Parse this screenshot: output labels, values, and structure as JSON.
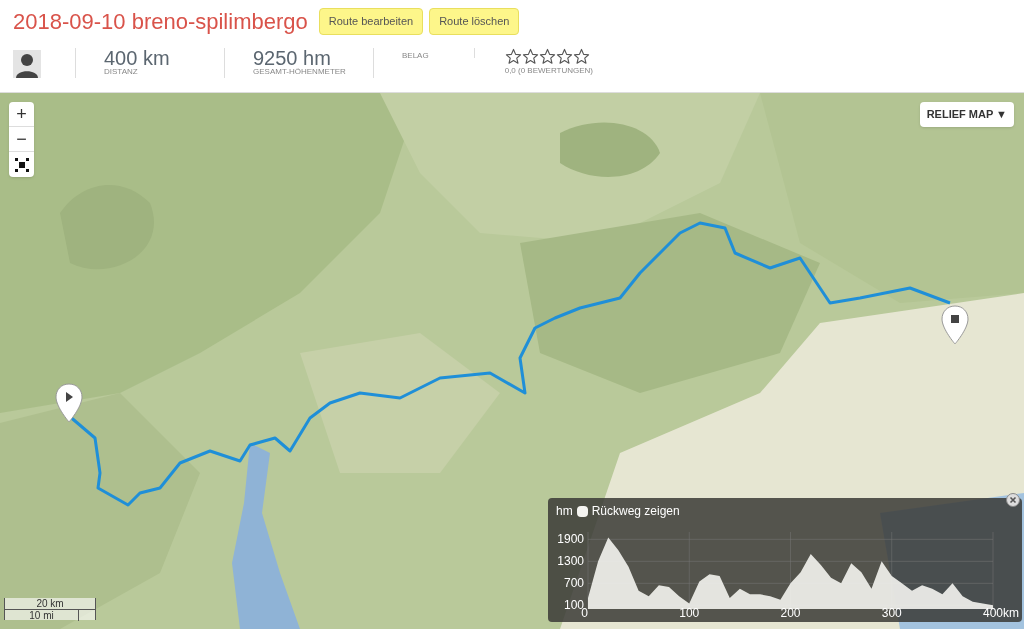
{
  "title": "2018-09-10 breno-spilimbergo",
  "actions": [
    "Route bearbeiten",
    "Route löschen"
  ],
  "stats": [
    {
      "value": "400 km",
      "label": "DISTANZ"
    },
    {
      "value": "9250 hm",
      "label": "GESAMT-HÖHENMETER"
    }
  ],
  "surface_label": "BELAG",
  "rating": {
    "stars": 0,
    "text": "0,0 (0 BEWERTUNGEN)"
  },
  "map": {
    "kind": "picture",
    "zoom_controls": [
      "+",
      "−"
    ],
    "layer_button": "RELIEF MAP ▼",
    "scale": [
      "20 km",
      "10 mi"
    ],
    "elevation": {
      "unit": "hm",
      "toggle_label": "Rückweg zeigen",
      "checked": false,
      "chart_data": {
        "type": "area",
        "xlabel": "km",
        "x": [
          0,
          10,
          20,
          30,
          40,
          50,
          60,
          70,
          80,
          90,
          100,
          110,
          120,
          130,
          140,
          150,
          160,
          170,
          180,
          190,
          200,
          210,
          220,
          230,
          240,
          250,
          260,
          270,
          280,
          290,
          300,
          310,
          320,
          330,
          340,
          350,
          360,
          370,
          380,
          390,
          400
        ],
        "series": [
          {
            "color": "#f4f4f0",
            "values": [
              300,
              1300,
              1950,
              1600,
              1150,
              500,
              350,
              650,
              600,
              350,
              150,
              750,
              950,
              900,
              300,
              550,
              400,
              400,
              350,
              250,
              700,
              1000,
              1500,
              1200,
              850,
              700,
              1250,
              1000,
              550,
              1300,
              900,
              700,
              500,
              650,
              550,
              400,
              700,
              350,
              200,
              150,
              100
            ]
          }
        ],
        "xlim": [
          0,
          400
        ],
        "ylim": [
          0,
          2100
        ],
        "xticks": [
          0,
          100,
          200,
          300,
          400
        ],
        "yticks": [
          100,
          700,
          1300,
          1900
        ],
        "grid": true
      }
    }
  }
}
